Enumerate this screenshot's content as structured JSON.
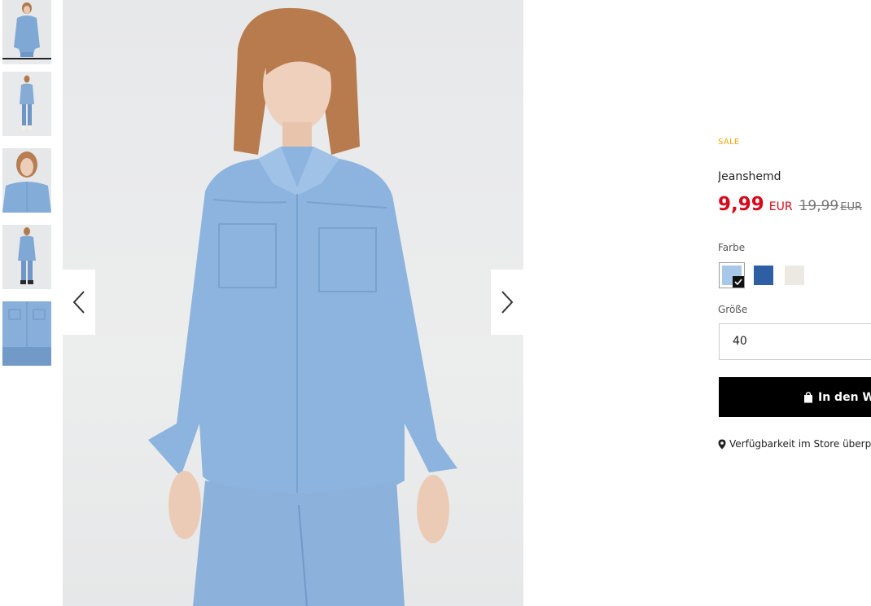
{
  "gallery": {
    "thumbnails": [
      {
        "name": "thumbnail-1",
        "active": true
      },
      {
        "name": "thumbnail-2",
        "active": false
      },
      {
        "name": "thumbnail-3",
        "active": false
      },
      {
        "name": "thumbnail-4",
        "active": false
      },
      {
        "name": "thumbnail-5",
        "active": false
      }
    ],
    "prev_icon": "chevron-left-icon",
    "next_icon": "chevron-right-icon"
  },
  "product": {
    "badge": "SALE",
    "name": "Jeanshemd",
    "price": "9,99",
    "currency": "EUR",
    "old_price": "19,99",
    "old_currency": "EUR",
    "color_label": "Farbe",
    "colors": [
      {
        "hex": "#a8c8ea",
        "selected": true
      },
      {
        "hex": "#2e5fa4",
        "selected": false
      },
      {
        "hex": "#ece9e3",
        "selected": false
      }
    ],
    "size_label": "Größe",
    "size_value": "40",
    "cart_button": "In den W",
    "cart_icon": "shopping-bag-icon",
    "store_link": "Verfügbarkeit im Store überp",
    "store_icon": "map-pin-icon"
  },
  "colors": {
    "sale_badge": "#f0a500",
    "price": "#d60a1b",
    "button_bg": "#000000"
  }
}
